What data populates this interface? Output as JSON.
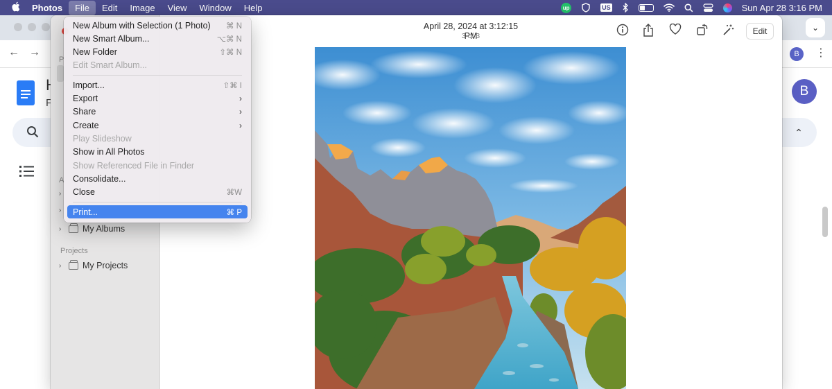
{
  "menubar": {
    "app_name": "Photos",
    "menus": [
      "File",
      "Edit",
      "Image",
      "View",
      "Window",
      "Help"
    ],
    "active_menu": "File",
    "status": {
      "up_badge": "up",
      "input_source": "US",
      "datetime": "Sun Apr 28  3:16 PM"
    }
  },
  "photos": {
    "header": {
      "date": "April 28, 2024 at 3:12:15 PM",
      "count": "3 of 3",
      "edit_label": "Edit"
    },
    "sidebar": {
      "section_projects": "Projects",
      "my_albums": "My Albums",
      "my_projects": "My Projects",
      "partial_labels": [
        "P",
        "A"
      ]
    }
  },
  "background_app": {
    "avatar_letter": "B",
    "mini_avatar_letter": "B",
    "heading_fragment": "H",
    "subtitle_fragment": "F"
  },
  "file_menu": {
    "items": [
      {
        "label": "New Album with Selection (1 Photo)",
        "shortcut": "⌘ N",
        "disabled": false
      },
      {
        "label": "New Smart Album...",
        "shortcut": "⌥⌘ N",
        "disabled": false
      },
      {
        "label": "New Folder",
        "shortcut": "⇧⌘ N",
        "disabled": false
      },
      {
        "label": "Edit Smart Album...",
        "shortcut": "",
        "disabled": true
      },
      {
        "label": "Import...",
        "shortcut": "⇧⌘ I",
        "disabled": false
      },
      {
        "label": "Export",
        "shortcut": "",
        "submenu": true,
        "disabled": false
      },
      {
        "label": "Share",
        "shortcut": "",
        "submenu": true,
        "disabled": false
      },
      {
        "label": "Create",
        "shortcut": "",
        "submenu": true,
        "disabled": false
      },
      {
        "label": "Play Slideshow",
        "shortcut": "",
        "disabled": true
      },
      {
        "label": "Show in All Photos",
        "shortcut": "",
        "disabled": false
      },
      {
        "label": "Show Referenced File in Finder",
        "shortcut": "",
        "disabled": true
      },
      {
        "label": "Consolidate...",
        "shortcut": "",
        "disabled": false
      },
      {
        "label": "Close",
        "shortcut": "⌘W",
        "disabled": false
      },
      {
        "label": "Print...",
        "shortcut": "⌘ P",
        "disabled": false,
        "selected": true
      }
    ]
  },
  "colors": {
    "menubar_bg": "#4a4b8c",
    "selection_blue": "#4584ee",
    "docs_blue": "#2a7cf6",
    "avatar_purple": "#5a5fc4"
  }
}
